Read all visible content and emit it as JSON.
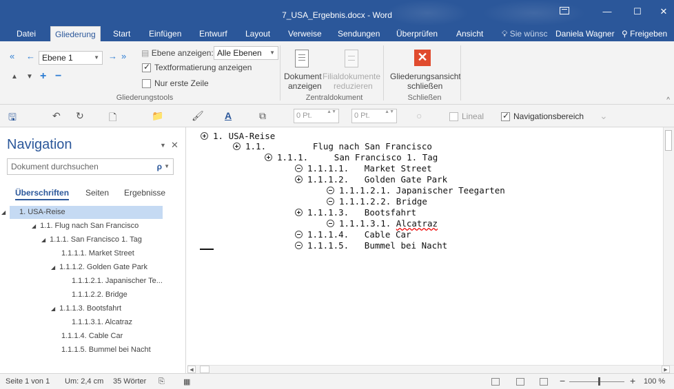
{
  "window": {
    "title": "7_USA_Ergebnis.docx - Word",
    "controls": {
      "minimize": "—",
      "maximize": "☐",
      "close": "✕"
    }
  },
  "tabs": [
    {
      "label": "Datei",
      "active": false
    },
    {
      "label": "Gliederung",
      "active": true
    },
    {
      "label": "Start",
      "active": false
    },
    {
      "label": "Einfügen",
      "active": false
    },
    {
      "label": "Entwurf",
      "active": false
    },
    {
      "label": "Layout",
      "active": false
    },
    {
      "label": "Verweise",
      "active": false
    },
    {
      "label": "Sendungen",
      "active": false
    },
    {
      "label": "Überprüfen",
      "active": false
    },
    {
      "label": "Ansicht",
      "active": false
    }
  ],
  "tell_me": {
    "icon": "lightbulb-icon",
    "text": "Sie wünsc"
  },
  "user": "Daniela Wagner",
  "share": {
    "icon": "person-icon",
    "label": "Freigeben"
  },
  "ribbon": {
    "level_select": "Ebene 1",
    "show_level_label": "Ebene anzeigen:",
    "show_level_value": "Alle Ebenen",
    "text_format": {
      "label": "Textformatierung anzeigen",
      "checked": true
    },
    "first_line": {
      "label": "Nur erste Zeile",
      "checked": false
    },
    "group_outline": "Gliederungstools",
    "show_doc": {
      "line1": "Dokument",
      "line2": "anzeigen"
    },
    "reduce_sub": {
      "line1": "Filialdokumente",
      "line2": "reduzieren"
    },
    "group_master": "Zentraldokument",
    "close_view": {
      "line1": "Gliederungsansicht",
      "line2": "schließen"
    },
    "group_close": "Schließen",
    "glyphs": {
      "promote_top": "«",
      "promote": "←",
      "demote": "→",
      "demote_body": "»",
      "move_up": "▲",
      "move_down": "▼",
      "expand": "+",
      "collapse": "−",
      "close_x": "✕",
      "dropdown": "▼",
      "collapse_ribbon": "^"
    }
  },
  "qat": {
    "spacing_before": "0 Pt.",
    "spacing_after": "0 Pt.",
    "ruler": {
      "label": "Lineal",
      "checked": false
    },
    "nav_pane": {
      "label": "Navigationsbereich",
      "checked": true
    },
    "glyphs": {
      "save": "🖫",
      "undo": "↶",
      "redo": "↻",
      "new_doc": "🗋",
      "open": "📁",
      "font_color": "A",
      "spin": "▲▼"
    }
  },
  "navigation": {
    "title": "Navigation",
    "search_placeholder": "Dokument durchsuchen",
    "tabs": [
      "Überschriften",
      "Seiten",
      "Ergebnisse"
    ],
    "glyphs": {
      "menu": "▼",
      "close": "✕",
      "search": "ρ",
      "expanded": "◢"
    },
    "items": [
      {
        "label": "1. USA-Reise",
        "selected": true
      },
      {
        "label": "1.1.  Flug nach San Francisco"
      },
      {
        "label": "1.1.1. San Francisco 1. Tag"
      },
      {
        "label": "1.1.1.1. Market Street"
      },
      {
        "label": "1.1.1.2. Golden Gate Park"
      },
      {
        "label": "1.1.1.2.1. Japanischer Te..."
      },
      {
        "label": "1.1.1.2.2. Bridge"
      },
      {
        "label": "1.1.1.3. Bootsfahrt"
      },
      {
        "label": "1.1.1.3.1. Alcatraz"
      },
      {
        "label": "1.1.1.4. Cable Car"
      },
      {
        "label": "1.1.1.5. Bummel bei Nacht"
      }
    ]
  },
  "outline": [
    {
      "num": "1.",
      "text": "USA-Reise",
      "expand": true
    },
    {
      "num": "1.1.",
      "text": "Flug nach San Francisco",
      "expand": true
    },
    {
      "num": "1.1.1.",
      "text": "San Francisco 1. Tag",
      "expand": true
    },
    {
      "num": "1.1.1.1.",
      "text": "Market Street",
      "expand": false
    },
    {
      "num": "1.1.1.2.",
      "text": "Golden Gate Park",
      "expand": true
    },
    {
      "num": "1.1.1.2.1.",
      "text": "Japanischer Teegarten",
      "expand": false
    },
    {
      "num": "1.1.1.2.2.",
      "text": "Bridge",
      "expand": false
    },
    {
      "num": "1.1.1.3.",
      "text": "Bootsfahrt",
      "expand": true
    },
    {
      "num": "1.1.1.3.1.",
      "text": "Alcatraz",
      "expand": false
    },
    {
      "num": "1.1.1.4.",
      "text": "Cable Car",
      "expand": false
    },
    {
      "num": "1.1.1.5.",
      "text": "Bummel bei Nacht",
      "expand": false
    }
  ],
  "status": {
    "page": "Seite 1 von 1",
    "position": "Um: 2,4 cm",
    "words": "35 Wörter",
    "zoom_minus": "−",
    "zoom_plus": "+",
    "zoom": "100 %"
  },
  "scroll_glyphs": {
    "left": "◀",
    "right": "▶"
  },
  "colors": {
    "accent": "#2b579a",
    "close_button": "#e04b2e",
    "selection": "#c5daf3"
  }
}
